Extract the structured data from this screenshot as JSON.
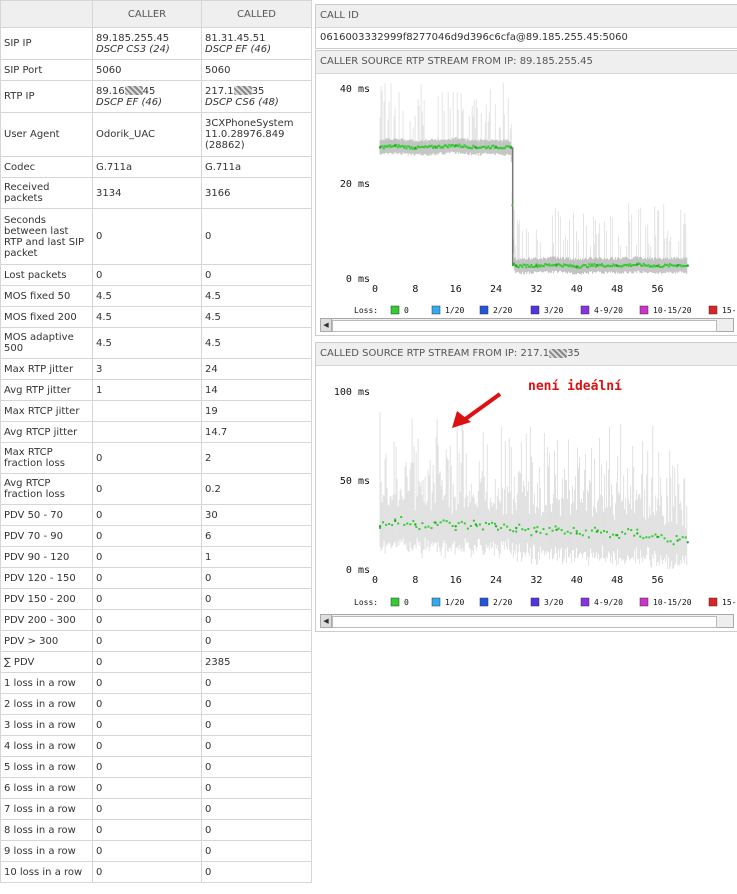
{
  "table": {
    "headers": [
      "",
      "CALLER",
      "CALLED"
    ],
    "rows": [
      {
        "label": "SIP IP",
        "caller": "89.185.255.45",
        "caller_dscp": "DSCP CS3 (24)",
        "called": "81.31.45.51",
        "called_dscp": "DSCP EF (46)"
      },
      {
        "label": "SIP Port",
        "caller": "5060",
        "called": "5060"
      },
      {
        "label": "RTP IP",
        "caller_pre": "89.16",
        "caller_post": "45",
        "caller_dscp": "DSCP EF (46)",
        "called_pre": "217.1",
        "called_post": "35",
        "called_dscp": "DSCP CS6 (48)"
      },
      {
        "label": "User Agent",
        "caller": "Odorik_UAC",
        "called": "3CXPhoneSystem 11.0.28976.849 (28862)"
      },
      {
        "label": "Codec",
        "caller": "G.711a",
        "called": "G.711a"
      },
      {
        "label": "Received packets",
        "caller": "3134",
        "called": "3166"
      },
      {
        "label": "Seconds between last RTP and last SIP packet",
        "caller": "0",
        "called": "0"
      },
      {
        "label": "Lost packets",
        "caller": "0",
        "called": "0"
      },
      {
        "label": "MOS fixed 50",
        "caller": "4.5",
        "called": "4.5"
      },
      {
        "label": "MOS fixed 200",
        "caller": "4.5",
        "called": "4.5"
      },
      {
        "label": "MOS adaptive 500",
        "caller": "4.5",
        "called": "4.5"
      },
      {
        "label": "Max RTP jitter",
        "caller": "3",
        "called": "24"
      },
      {
        "label": "Avg RTP jitter",
        "caller": "1",
        "called": "14"
      },
      {
        "label": "Max RTCP jitter",
        "caller": "",
        "called": "19"
      },
      {
        "label": "Avg RTCP jitter",
        "caller": "",
        "called": "14.7"
      },
      {
        "label": "Max RTCP fraction loss",
        "caller": "0",
        "called": "2"
      },
      {
        "label": "Avg RTCP fraction loss",
        "caller": "0",
        "called": "0.2"
      },
      {
        "label": "PDV 50 - 70",
        "caller": "0",
        "called": "30"
      },
      {
        "label": "PDV 70 - 90",
        "caller": "0",
        "called": "6"
      },
      {
        "label": "PDV 90 - 120",
        "caller": "0",
        "called": "1"
      },
      {
        "label": "PDV 120 - 150",
        "caller": "0",
        "called": "0"
      },
      {
        "label": "PDV 150 - 200",
        "caller": "0",
        "called": "0"
      },
      {
        "label": "PDV 200 - 300",
        "caller": "0",
        "called": "0"
      },
      {
        "label": "PDV > 300",
        "caller": "0",
        "called": "0"
      },
      {
        "label": "∑ PDV",
        "caller": "0",
        "called": "2385"
      },
      {
        "label": "1 loss in a row",
        "caller": "0",
        "called": "0"
      },
      {
        "label": "2 loss in a row",
        "caller": "0",
        "called": "0"
      },
      {
        "label": "3 loss in a row",
        "caller": "0",
        "called": "0"
      },
      {
        "label": "4 loss in a row",
        "caller": "0",
        "called": "0"
      },
      {
        "label": "5 loss in a row",
        "caller": "0",
        "called": "0"
      },
      {
        "label": "6 loss in a row",
        "caller": "0",
        "called": "0"
      },
      {
        "label": "7 loss in a row",
        "caller": "0",
        "called": "0"
      },
      {
        "label": "8 loss in a row",
        "caller": "0",
        "called": "0"
      },
      {
        "label": "9 loss in a row",
        "caller": "0",
        "called": "0"
      },
      {
        "label": "10 loss in a row",
        "caller": "0",
        "called": "0"
      }
    ]
  },
  "callid": {
    "header": "CALL ID",
    "value": "0616003332999f8277046d9d396c6cfa@89.185.255.45:5060"
  },
  "panel1": {
    "header": "CALLER SOURCE RTP STREAM FROM IP: 89.185.255.45"
  },
  "panel2": {
    "header_pre": "CALLED SOURCE RTP STREAM FROM IP: 217.1",
    "header_post": "35"
  },
  "annotation": {
    "text": "není ideální",
    "color": "#dd1111"
  },
  "legend": {
    "title": "Loss:",
    "items": [
      {
        "label": "0",
        "color": "#33cc33"
      },
      {
        "label": "1/20",
        "color": "#33aaee"
      },
      {
        "label": "2/20",
        "color": "#2255dd"
      },
      {
        "label": "3/20",
        "color": "#5533dd"
      },
      {
        "label": "4-9/20",
        "color": "#8833dd"
      },
      {
        "label": "10-15/20",
        "color": "#cc33cc"
      },
      {
        "label": "15-",
        "color": "#dd2222"
      }
    ]
  },
  "chart_data": [
    {
      "type": "line",
      "title": "CALLER SOURCE RTP STREAM FROM IP: 89.185.255.45",
      "yticks": [
        "40 ms",
        "20 ms",
        "0 ms"
      ],
      "ylim": [
        0,
        40
      ],
      "xticks": [
        0,
        8,
        16,
        24,
        32,
        40,
        48,
        56
      ],
      "xlim": [
        0,
        68
      ],
      "series": [
        {
          "x": [
            1,
            4,
            8,
            12,
            16,
            20,
            24,
            27,
            27.5,
            28,
            32,
            36,
            40,
            44,
            48,
            52,
            56,
            60,
            62
          ],
          "values": [
            27.5,
            27.8,
            27.4,
            27.6,
            27.9,
            27.5,
            27.6,
            27.4,
            3,
            2.5,
            2.6,
            2.8,
            2.4,
            2.7,
            2.6,
            2.8,
            2.5,
            2.7,
            2.6
          ]
        }
      ],
      "grid": false
    },
    {
      "type": "line",
      "title": "CALLED SOURCE RTP STREAM FROM IP: 217.1 35",
      "yticks": [
        "100 ms",
        "50 ms",
        "0 ms"
      ],
      "ylim": [
        0,
        100
      ],
      "xticks": [
        0,
        8,
        16,
        24,
        32,
        40,
        48,
        56
      ],
      "xlim": [
        0,
        68
      ],
      "series": [
        {
          "x": [
            1,
            4,
            8,
            12,
            16,
            20,
            24,
            28,
            32,
            36,
            40,
            44,
            48,
            52,
            56,
            60,
            62
          ],
          "values": [
            24,
            27,
            25,
            26,
            24,
            25,
            24,
            23,
            21,
            22,
            20,
            21,
            19,
            20,
            18,
            16,
            15
          ]
        }
      ],
      "grid": false
    }
  ]
}
